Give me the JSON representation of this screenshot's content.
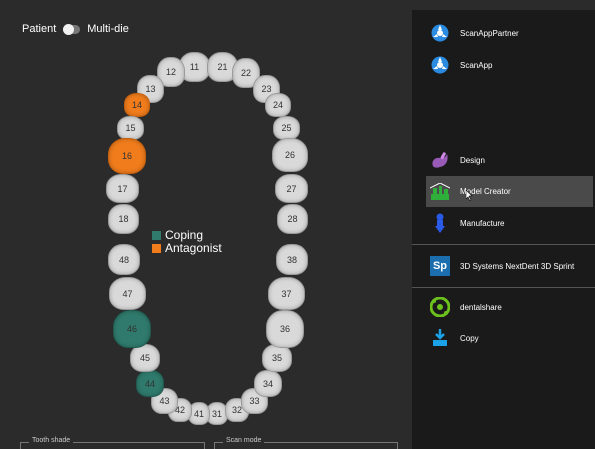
{
  "header": {
    "patient_label": "Patient",
    "multidie_label": "Multi-die"
  },
  "colors": {
    "coping": "#2f7a6c",
    "antagonist": "#f07c1c",
    "tooth": "#d9d9d9"
  },
  "teeth": [
    {
      "num": "11",
      "status": "normal"
    },
    {
      "num": "12",
      "status": "normal"
    },
    {
      "num": "13",
      "status": "normal"
    },
    {
      "num": "14",
      "status": "antagonist"
    },
    {
      "num": "15",
      "status": "normal"
    },
    {
      "num": "16",
      "status": "antagonist"
    },
    {
      "num": "17",
      "status": "normal"
    },
    {
      "num": "18",
      "status": "normal"
    },
    {
      "num": "21",
      "status": "normal"
    },
    {
      "num": "22",
      "status": "normal"
    },
    {
      "num": "23",
      "status": "normal"
    },
    {
      "num": "24",
      "status": "normal"
    },
    {
      "num": "25",
      "status": "normal"
    },
    {
      "num": "26",
      "status": "normal"
    },
    {
      "num": "27",
      "status": "normal"
    },
    {
      "num": "28",
      "status": "normal"
    },
    {
      "num": "31",
      "status": "normal"
    },
    {
      "num": "32",
      "status": "normal"
    },
    {
      "num": "33",
      "status": "normal"
    },
    {
      "num": "34",
      "status": "normal"
    },
    {
      "num": "35",
      "status": "normal"
    },
    {
      "num": "36",
      "status": "normal"
    },
    {
      "num": "37",
      "status": "normal"
    },
    {
      "num": "38",
      "status": "normal"
    },
    {
      "num": "41",
      "status": "normal"
    },
    {
      "num": "42",
      "status": "normal"
    },
    {
      "num": "43",
      "status": "normal"
    },
    {
      "num": "44",
      "status": "coping"
    },
    {
      "num": "45",
      "status": "normal"
    },
    {
      "num": "46",
      "status": "coping"
    },
    {
      "num": "47",
      "status": "normal"
    },
    {
      "num": "48",
      "status": "normal"
    }
  ],
  "legend": {
    "coping": "Coping",
    "antagonist": "Antagonist"
  },
  "bottom": {
    "tooth_shade": "Tooth shade",
    "scan_mode": "Scan mode"
  },
  "apps": [
    {
      "label": "ScanAppPartner",
      "icon": "scanapp-partner-icon"
    },
    {
      "label": "ScanApp",
      "icon": "scanapp-icon"
    },
    {
      "label": "Design",
      "icon": "design-icon"
    },
    {
      "label": "Model Creator",
      "icon": "model-creator-icon",
      "selected": true
    },
    {
      "label": "Manufacture",
      "icon": "manufacture-icon"
    },
    {
      "label": "3D Systems NextDent 3D Sprint",
      "icon": "nextdent-sp-icon",
      "badge": "Sp"
    },
    {
      "label": "dentalshare",
      "icon": "dentalshare-icon"
    },
    {
      "label": "Copy",
      "icon": "copy-icon"
    }
  ]
}
